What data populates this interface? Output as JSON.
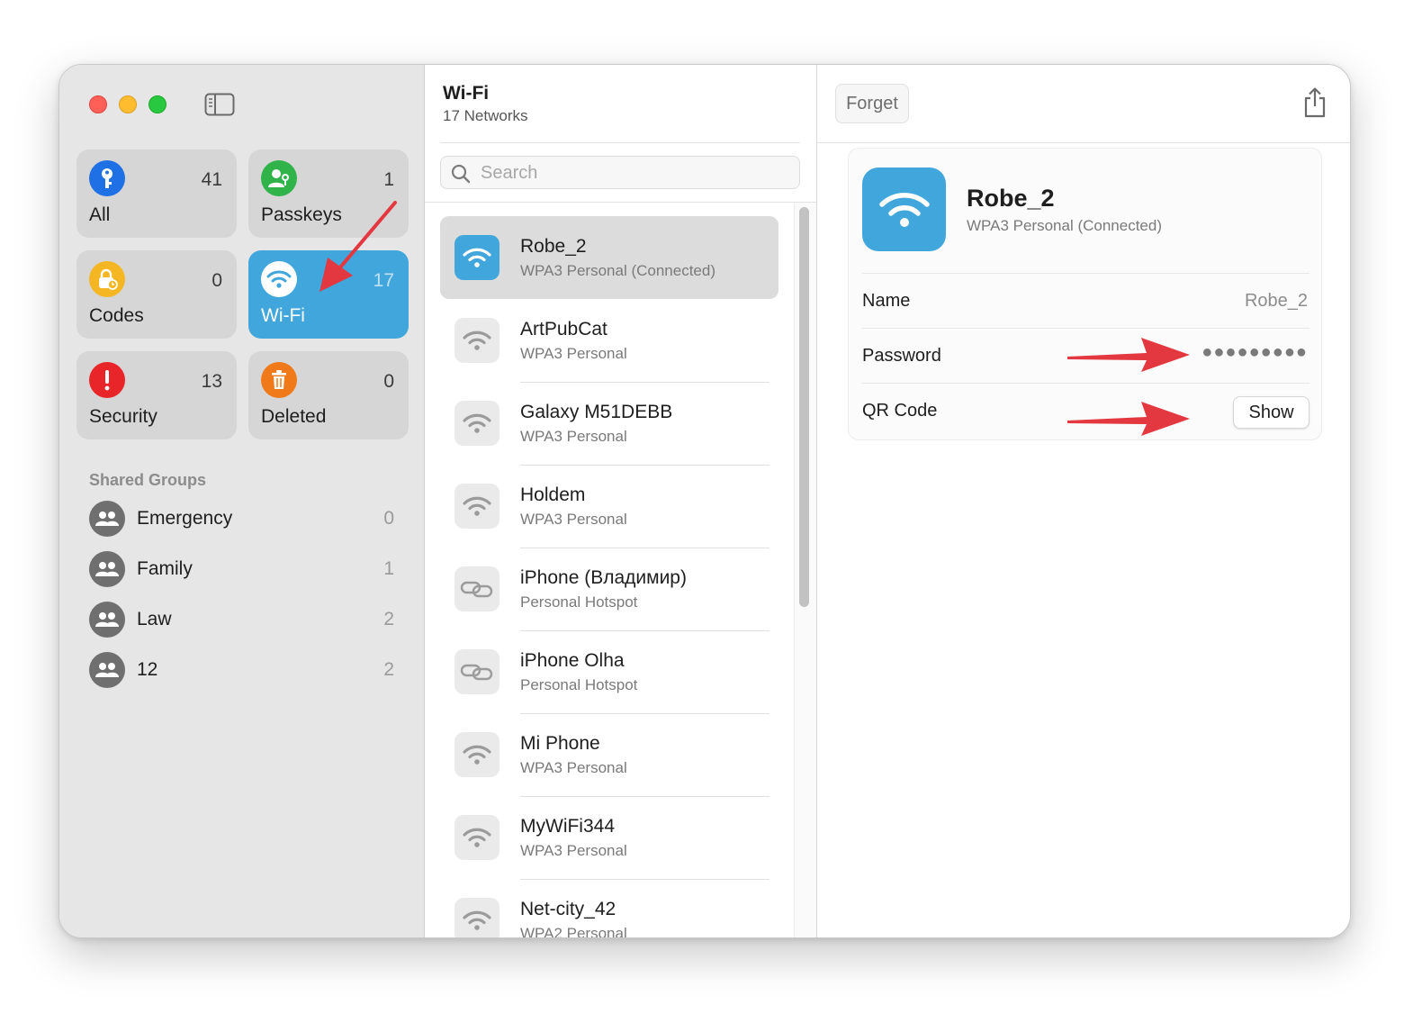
{
  "colors": {
    "accent": "#41a6dc",
    "all": "#1f6fe5",
    "passkeys": "#30b44a",
    "codes": "#f5b623",
    "security": "#e8262a",
    "deleted": "#f07a1a",
    "annotation": "#e3383f"
  },
  "sidebar": {
    "tiles": [
      {
        "label": "All",
        "count": "41",
        "icon": "key-icon"
      },
      {
        "label": "Passkeys",
        "count": "1",
        "icon": "person-key-icon"
      },
      {
        "label": "Codes",
        "count": "0",
        "icon": "lock-clock-icon"
      },
      {
        "label": "Wi-Fi",
        "count": "17",
        "icon": "wifi-icon"
      },
      {
        "label": "Security",
        "count": "13",
        "icon": "exclamation-icon"
      },
      {
        "label": "Deleted",
        "count": "0",
        "icon": "trash-icon"
      }
    ],
    "shared_groups_heading": "Shared Groups",
    "groups": [
      {
        "name": "Emergency",
        "count": "0"
      },
      {
        "name": "Family",
        "count": "1"
      },
      {
        "name": "Law",
        "count": "2"
      },
      {
        "name": "12",
        "count": "2"
      }
    ]
  },
  "list": {
    "title": "Wi-Fi",
    "subtitle": "17 Networks",
    "search_placeholder": "Search",
    "items": [
      {
        "name": "Robe_2",
        "detail": "WPA3 Personal (Connected)",
        "icon": "wifi-icon"
      },
      {
        "name": "ArtPubCat",
        "detail": "WPA3 Personal",
        "icon": "wifi-icon"
      },
      {
        "name": "Galaxy M51DEBB",
        "detail": "WPA3 Personal",
        "icon": "wifi-icon"
      },
      {
        "name": "Holdem",
        "detail": "WPA3 Personal",
        "icon": "wifi-icon"
      },
      {
        "name": "iPhone (Владимир)",
        "detail": "Personal Hotspot",
        "icon": "hotspot-link-icon"
      },
      {
        "name": "iPhone Olha",
        "detail": "Personal Hotspot",
        "icon": "hotspot-link-icon"
      },
      {
        "name": "Mi Phone",
        "detail": "WPA3 Personal",
        "icon": "wifi-icon"
      },
      {
        "name": "MyWiFi344",
        "detail": "WPA3 Personal",
        "icon": "wifi-icon"
      },
      {
        "name": "Net-city_42",
        "detail": "WPA2 Personal",
        "icon": "wifi-icon"
      }
    ]
  },
  "detail": {
    "forget_label": "Forget",
    "title": "Robe_2",
    "subtitle": "WPA3 Personal (Connected)",
    "name_label": "Name",
    "name_value": "Robe_2",
    "password_label": "Password",
    "password_value": "●●●●●●●●●",
    "qr_label": "QR Code",
    "show_label": "Show"
  }
}
